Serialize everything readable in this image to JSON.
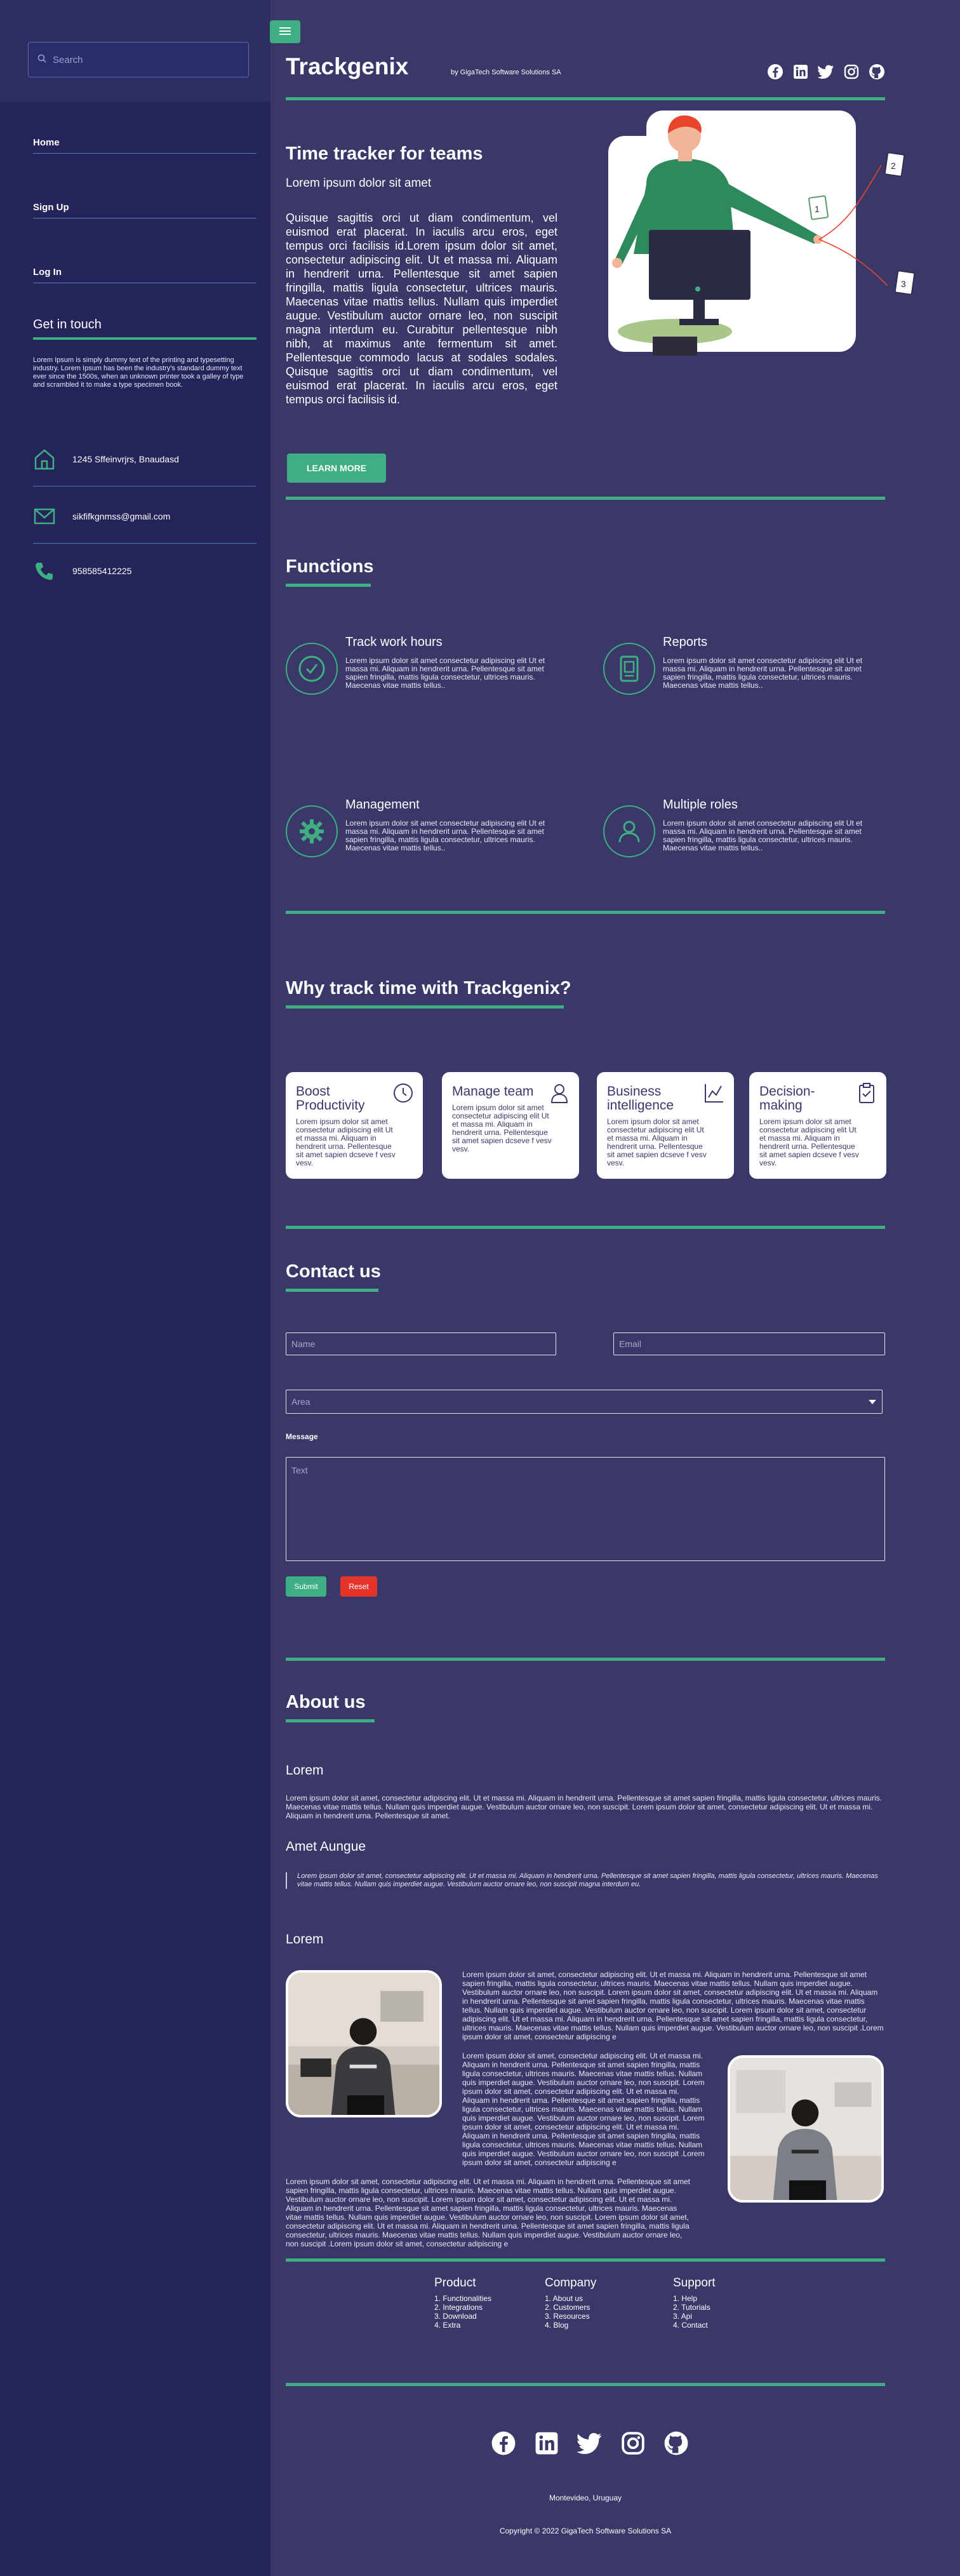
{
  "sidebar": {
    "search_placeholder": "Search",
    "nav": [
      "Home",
      "Sign Up",
      "Log In"
    ],
    "get_in_touch": {
      "title": "Get in touch",
      "text": "Lorem Ipsum is simply dummy text of the printing and typesetting industry. Lorem Ipsum has been the industry's standard dummy text ever since the 1500s, when an unknown printer took a galley of type and scrambled it to make a type specimen book."
    },
    "address": "1245 Sffeinvrjrs, Bnaudasd",
    "email": "sikfifkgnmss@gmail.com",
    "phone": "958585412225"
  },
  "header": {
    "brand": "Trackgenix",
    "brand_sub": "by GigaTech Software Solutions SA",
    "social_icons": [
      "facebook-icon",
      "linkedin-icon",
      "twitter-icon",
      "instagram-icon",
      "github-icon"
    ]
  },
  "hero": {
    "title": "Time tracker for teams",
    "subtitle": "Lorem ipsum dolor sit amet",
    "text": "Quisque sagittis orci ut diam condimentum, vel euismod erat placerat. In iaculis arcu eros, eget tempus orci facilisis id.Lorem ipsum dolor sit amet, consectetur adipiscing elit. Ut et massa mi. Aliquam in hendrerit urna. Pellentesque sit amet sapien fringilla, mattis ligula consectetur, ultrices mauris. Maecenas vitae mattis tellus. Nullam quis imperdiet augue. Vestibulum auctor ornare leo, non suscipit magna interdum eu. Curabitur pellentesque nibh nibh, at maximus ante fermentum sit amet. Pellentesque commodo lacus at sodales sodales. Quisque sagittis orci ut diam condimentum, vel euismod erat placerat. In iaculis arcu eros, eget tempus orci facilisis id.",
    "button": "LEARN MORE",
    "illus_labels": [
      "1",
      "2",
      "3"
    ]
  },
  "functions": {
    "title": "Functions",
    "items": [
      {
        "title": "Track work hours",
        "text": "Lorem ipsum dolor sit amet consectetur adipiscing elit Ut et massa mi. Aliquam in hendrerit urna. Pellentesque sit amet sapien fringilla, mattis ligula consectetur, ultrices mauris. Maecenas vitae mattis tellus.."
      },
      {
        "title": "Reports",
        "text": "Lorem ipsum dolor sit amet consectetur adipiscing elit Ut et massa mi. Aliquam in hendrerit urna. Pellentesque sit amet sapien fringilla, mattis ligula consectetur, ultrices mauris. Maecenas vitae mattis tellus.."
      },
      {
        "title": "Management",
        "text": "Lorem ipsum dolor sit amet consectetur adipiscing elit Ut et massa mi. Aliquam in hendrerit urna. Pellentesque sit amet sapien fringilla, mattis ligula consectetur, ultrices mauris. Maecenas vitae mattis tellus.."
      },
      {
        "title": "Multiple roles",
        "text": "Lorem ipsum dolor sit amet consectetur adipiscing elit Ut et massa mi. Aliquam in hendrerit urna. Pellentesque sit amet sapien fringilla, mattis ligula consectetur, ultrices mauris. Maecenas vitae mattis tellus.."
      }
    ]
  },
  "why": {
    "title": "Why track time with Trackgenix?",
    "cards": [
      {
        "title": "Boost Productivity",
        "text": "Lorem ipsum dolor sit amet consectetur adipiscing elit Ut et massa mi. Aliquam in hendrerit urna. Pellentesque sit amet sapien dcseve f vesv vesv.",
        "icon": "clock-icon"
      },
      {
        "title": "Manage team",
        "text": "Lorem ipsum dolor sit amet consectetur adipiscing elit Ut et massa mi. Aliquam in hendrerit urna. Pellentesque sit amet sapien dcseve f vesv vesv.",
        "icon": "user-icon"
      },
      {
        "title": "Business intelligence",
        "text": "Lorem ipsum dolor sit amet consectetur adipiscing elit Ut et massa mi. Aliquam in hendrerit urna. Pellentesque sit amet sapien dcseve f vesv vesv.",
        "icon": "chart-icon"
      },
      {
        "title": "Decision-making",
        "text": "Lorem ipsum dolor sit amet consectetur adipiscing elit Ut et massa mi. Aliquam in hendrerit urna. Pellentesque sit amet sapien dcseve f vesv vesv.",
        "icon": "clipboard-icon"
      }
    ]
  },
  "contact": {
    "title": "Contact us",
    "name_placeholder": "Name",
    "email_placeholder": "Email",
    "area_placeholder": "Area",
    "message_label": "Message",
    "text_placeholder": "Text",
    "submit": "Submit",
    "reset": "Reset"
  },
  "about": {
    "title": "About us",
    "h1": "Lorem",
    "p1": "Lorem ipsum dolor sit amet, consectetur adipiscing elit. Ut et massa mi. Aliquam in hendrerit urna. Pellentesque sit amet sapien fringilla, mattis ligula consectetur, ultrices mauris. Maecenas vitae mattis tellus. Nullam quis imperdiet augue. Vestibulum auctor ornare leo, non suscipit. Lorem ipsum dolor sit amet, consectetur adipiscing elit. Ut et massa mi. Aliquam in hendrerit urna. Pellentesque sit amet.",
    "h2": "Amet Aungue",
    "quote": "Lorem ipsum dolor sit amet, consectetur adipiscing elit. Ut et massa mi. Aliquam in hendrerit urna. Pellentesque sit amet sapien fringilla, mattis ligula consectetur, ultrices mauris. Maecenas vitae mattis tellus. Nullam quis imperdiet augue. Vestibulum auctor ornare leo, non suscipit magna interdum eu.",
    "h3": "Lorem",
    "flow1": "Lorem ipsum dolor sit amet, consectetur adipiscing elit. Ut et massa mi. Aliquam in hendrerit urna. Pellentesque sit amet sapien fringilla, mattis ligula consectetur, ultrices mauris. Maecenas vitae mattis tellus. Nullam quis imperdiet augue. Vestibulum auctor ornare leo, non suscipit. Lorem ipsum dolor sit amet, consectetur adipiscing elit. Ut et massa mi. Aliquam in hendrerit urna. Pellentesque sit amet sapien fringilla, mattis ligula consectetur, ultrices mauris. Maecenas vitae mattis tellus. Nullam quis imperdiet augue. Vestibulum auctor ornare leo, non suscipit. Lorem ipsum dolor sit amet, consectetur adipiscing elit. Ut et massa mi. Aliquam in hendrerit urna. Pellentesque sit amet sapien fringilla, mattis ligula consectetur, ultrices mauris. Maecenas vitae mattis tellus. Nullam quis imperdiet augue. Vestibulum auctor ornare leo, non suscipit .Lorem ipsum dolor sit amet, consectetur adipiscing e",
    "flow2": "Lorem ipsum dolor sit amet, consectetur adipiscing elit. Ut et massa mi. Aliquam in hendrerit urna. Pellentesque sit amet sapien fringilla, mattis ligula consectetur, ultrices mauris. Maecenas vitae mattis tellus. Nullam quis imperdiet augue. Vestibulum auctor ornare leo, non suscipit. Lorem ipsum dolor sit amet, consectetur adipiscing elit. Ut et massa mi. Aliquam in hendrerit urna. Pellentesque sit amet sapien fringilla, mattis ligula consectetur, ultrices mauris. Maecenas vitae mattis tellus. Nullam quis imperdiet augue. Vestibulum auctor ornare leo, non suscipit. Lorem ipsum dolor sit amet, consectetur adipiscing elit. Ut et massa mi. Aliquam in hendrerit urna. Pellentesque sit amet sapien fringilla, mattis ligula consectetur, ultrices mauris. Maecenas vitae mattis tellus. Nullam quis imperdiet augue. Vestibulum auctor ornare leo, non suscipit .Lorem ipsum dolor sit amet, consectetur adipiscing e",
    "flow3": "Lorem ipsum dolor sit amet, consectetur adipiscing elit. Ut et massa mi. Aliquam in hendrerit urna. Pellentesque sit amet sapien fringilla, mattis ligula consectetur, ultrices mauris. Maecenas vitae mattis tellus. Nullam quis imperdiet augue. Vestibulum auctor ornare leo, non suscipit. Lorem ipsum dolor sit amet, consectetur adipiscing elit. Ut et massa mi. Aliquam in hendrerit urna. Pellentesque sit amet sapien fringilla, mattis ligula consectetur, ultrices mauris. Maecenas vitae mattis tellus. Nullam quis imperdiet augue. Vestibulum auctor ornare leo, non suscipit. Lorem ipsum dolor sit amet, consectetur adipiscing elit. Ut et massa mi. Aliquam in hendrerit urna. Pellentesque sit amet sapien fringilla, mattis ligula consectetur, ultrices mauris. Maecenas vitae mattis tellus. Nullam quis imperdiet augue. Vestibulum auctor ornare leo, non suscipit .Lorem ipsum dolor sit amet, consectetur adipiscing e"
  },
  "footer": {
    "columns": [
      {
        "title": "Product",
        "items": [
          "1. Functionalities",
          "2. Integrations",
          "3. Download",
          "4. Extra"
        ]
      },
      {
        "title": "Company",
        "items": [
          "1. About us",
          "2. Customers",
          "3. Resources",
          "4. Blog"
        ]
      },
      {
        "title": "Support",
        "items": [
          "1. Help",
          "2. Tutorials",
          "3. Api",
          "4. Contact"
        ]
      }
    ],
    "location": "Montevideo, Uruguay",
    "copyright": "Copyright © 2022  GigaTech Software Solutions SA"
  },
  "colors": {
    "accent": "#3fae82",
    "bg": "#393868",
    "sidebar": "#24245a",
    "reset": "#e5352b"
  }
}
